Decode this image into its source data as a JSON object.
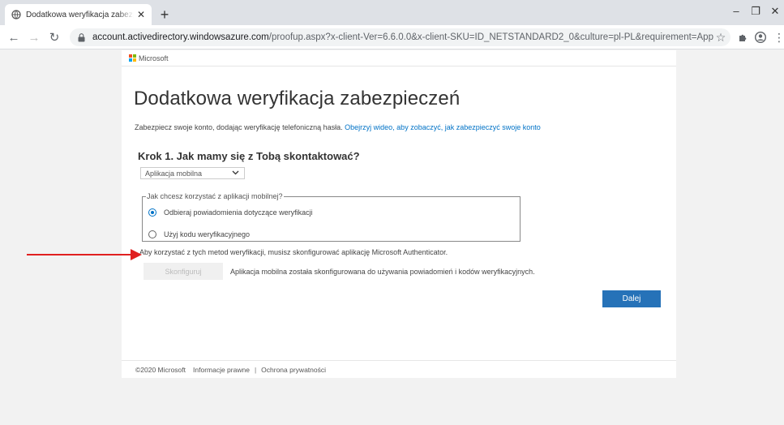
{
  "browser": {
    "tab_title": "Dodatkowa weryfikacja zabezpiecze",
    "url_host": "account.activedirectory.windowsazure.com",
    "url_path": "/proofup.aspx?x-client-Ver=6.6.0.0&x-client-SKU=ID_NETSTANDARD2_0&culture=pl-PL&requirement=App"
  },
  "header": {
    "brand": "Microsoft"
  },
  "main": {
    "title": "Dodatkowa weryfikacja zabezpieczeń",
    "intro_text": "Zabezpiecz swoje konto, dodając weryfikację telefoniczną hasła.",
    "intro_link": "Obejrzyj wideo, aby zobaczyć, jak zabezpieczyć swoje konto",
    "step_heading": "Krok 1. Jak mamy się z Tobą skontaktować?",
    "contact_method_selected": "Aplikacja mobilna",
    "mobile_group_legend": "Jak chcesz korzystać z aplikacji mobilnej?",
    "option_notifications": "Odbieraj powiadomienia dotyczące weryfikacji",
    "option_code": "Użyj kodu weryfikacyjnego",
    "authenticator_note": "Aby korzystać z tych metod weryfikacji, musisz skonfigurować aplikację Microsoft Authenticator.",
    "configure_button": "Skonfiguruj",
    "configure_status": "Aplikacja mobilna została skonfigurowana do używania powiadomień i kodów weryfikacyjnych.",
    "next_button": "Dalej"
  },
  "footer": {
    "copyright": "©2020 Microsoft",
    "legal": "Informacje prawne",
    "separator": "|",
    "privacy": "Ochrona prywatności"
  },
  "colors": {
    "accent": "#0072c6",
    "next_button": "#2672b8",
    "annotation_arrow": "#e02020"
  }
}
